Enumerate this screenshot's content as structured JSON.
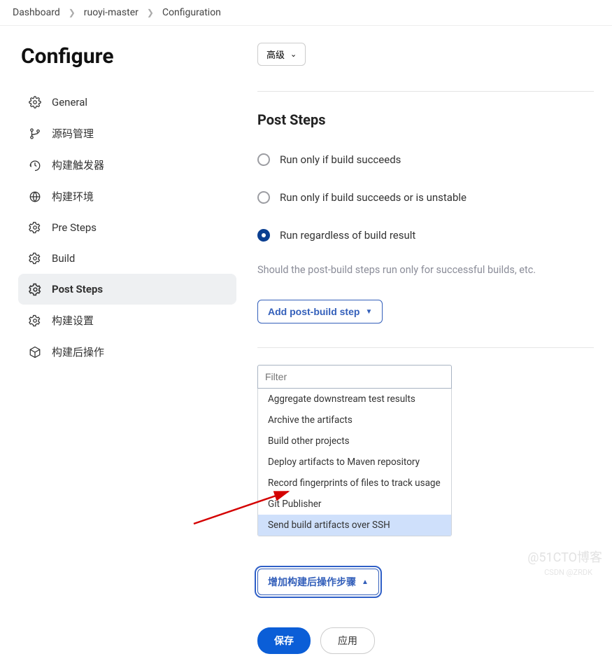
{
  "breadcrumb": {
    "items": [
      "Dashboard",
      "ruoyi-master",
      "Configuration"
    ]
  },
  "page_title": "Configure",
  "sidebar": {
    "items": [
      {
        "label": "General",
        "icon": "gear-icon"
      },
      {
        "label": "源码管理",
        "icon": "branch-icon"
      },
      {
        "label": "构建触发器",
        "icon": "clock-icon"
      },
      {
        "label": "构建环境",
        "icon": "globe-icon"
      },
      {
        "label": "Pre Steps",
        "icon": "gear-icon"
      },
      {
        "label": "Build",
        "icon": "gear-icon"
      },
      {
        "label": "Post Steps",
        "icon": "gear-icon",
        "active": true
      },
      {
        "label": "构建设置",
        "icon": "gear-icon"
      },
      {
        "label": "构建后操作",
        "icon": "cube-icon"
      }
    ]
  },
  "advanced_btn_label": "高级",
  "section_heading": "Post Steps",
  "radios": {
    "options": [
      {
        "label": "Run only if build succeeds",
        "selected": false
      },
      {
        "label": "Run only if build succeeds or is unstable",
        "selected": false
      },
      {
        "label": "Run regardless of build result",
        "selected": true
      }
    ],
    "description": "Should the post-build steps run only for successful builds, etc."
  },
  "add_post_build_step_label": "Add post-build step",
  "filter_placeholder": "Filter",
  "dropdown_items": [
    {
      "label": "Aggregate downstream test results"
    },
    {
      "label": "Archive the artifacts"
    },
    {
      "label": "Build other projects"
    },
    {
      "label": "Deploy artifacts to Maven repository"
    },
    {
      "label": "Record fingerprints of files to track usage"
    },
    {
      "label": "Git Publisher"
    },
    {
      "label": "Send build artifacts over SSH",
      "highlight": true
    }
  ],
  "add_post_action_label": "增加构建后操作步骤",
  "footer": {
    "save": "保存",
    "apply": "应用"
  },
  "watermark1": "@51CTO博客",
  "watermark2": "CSDN @ZRDK"
}
